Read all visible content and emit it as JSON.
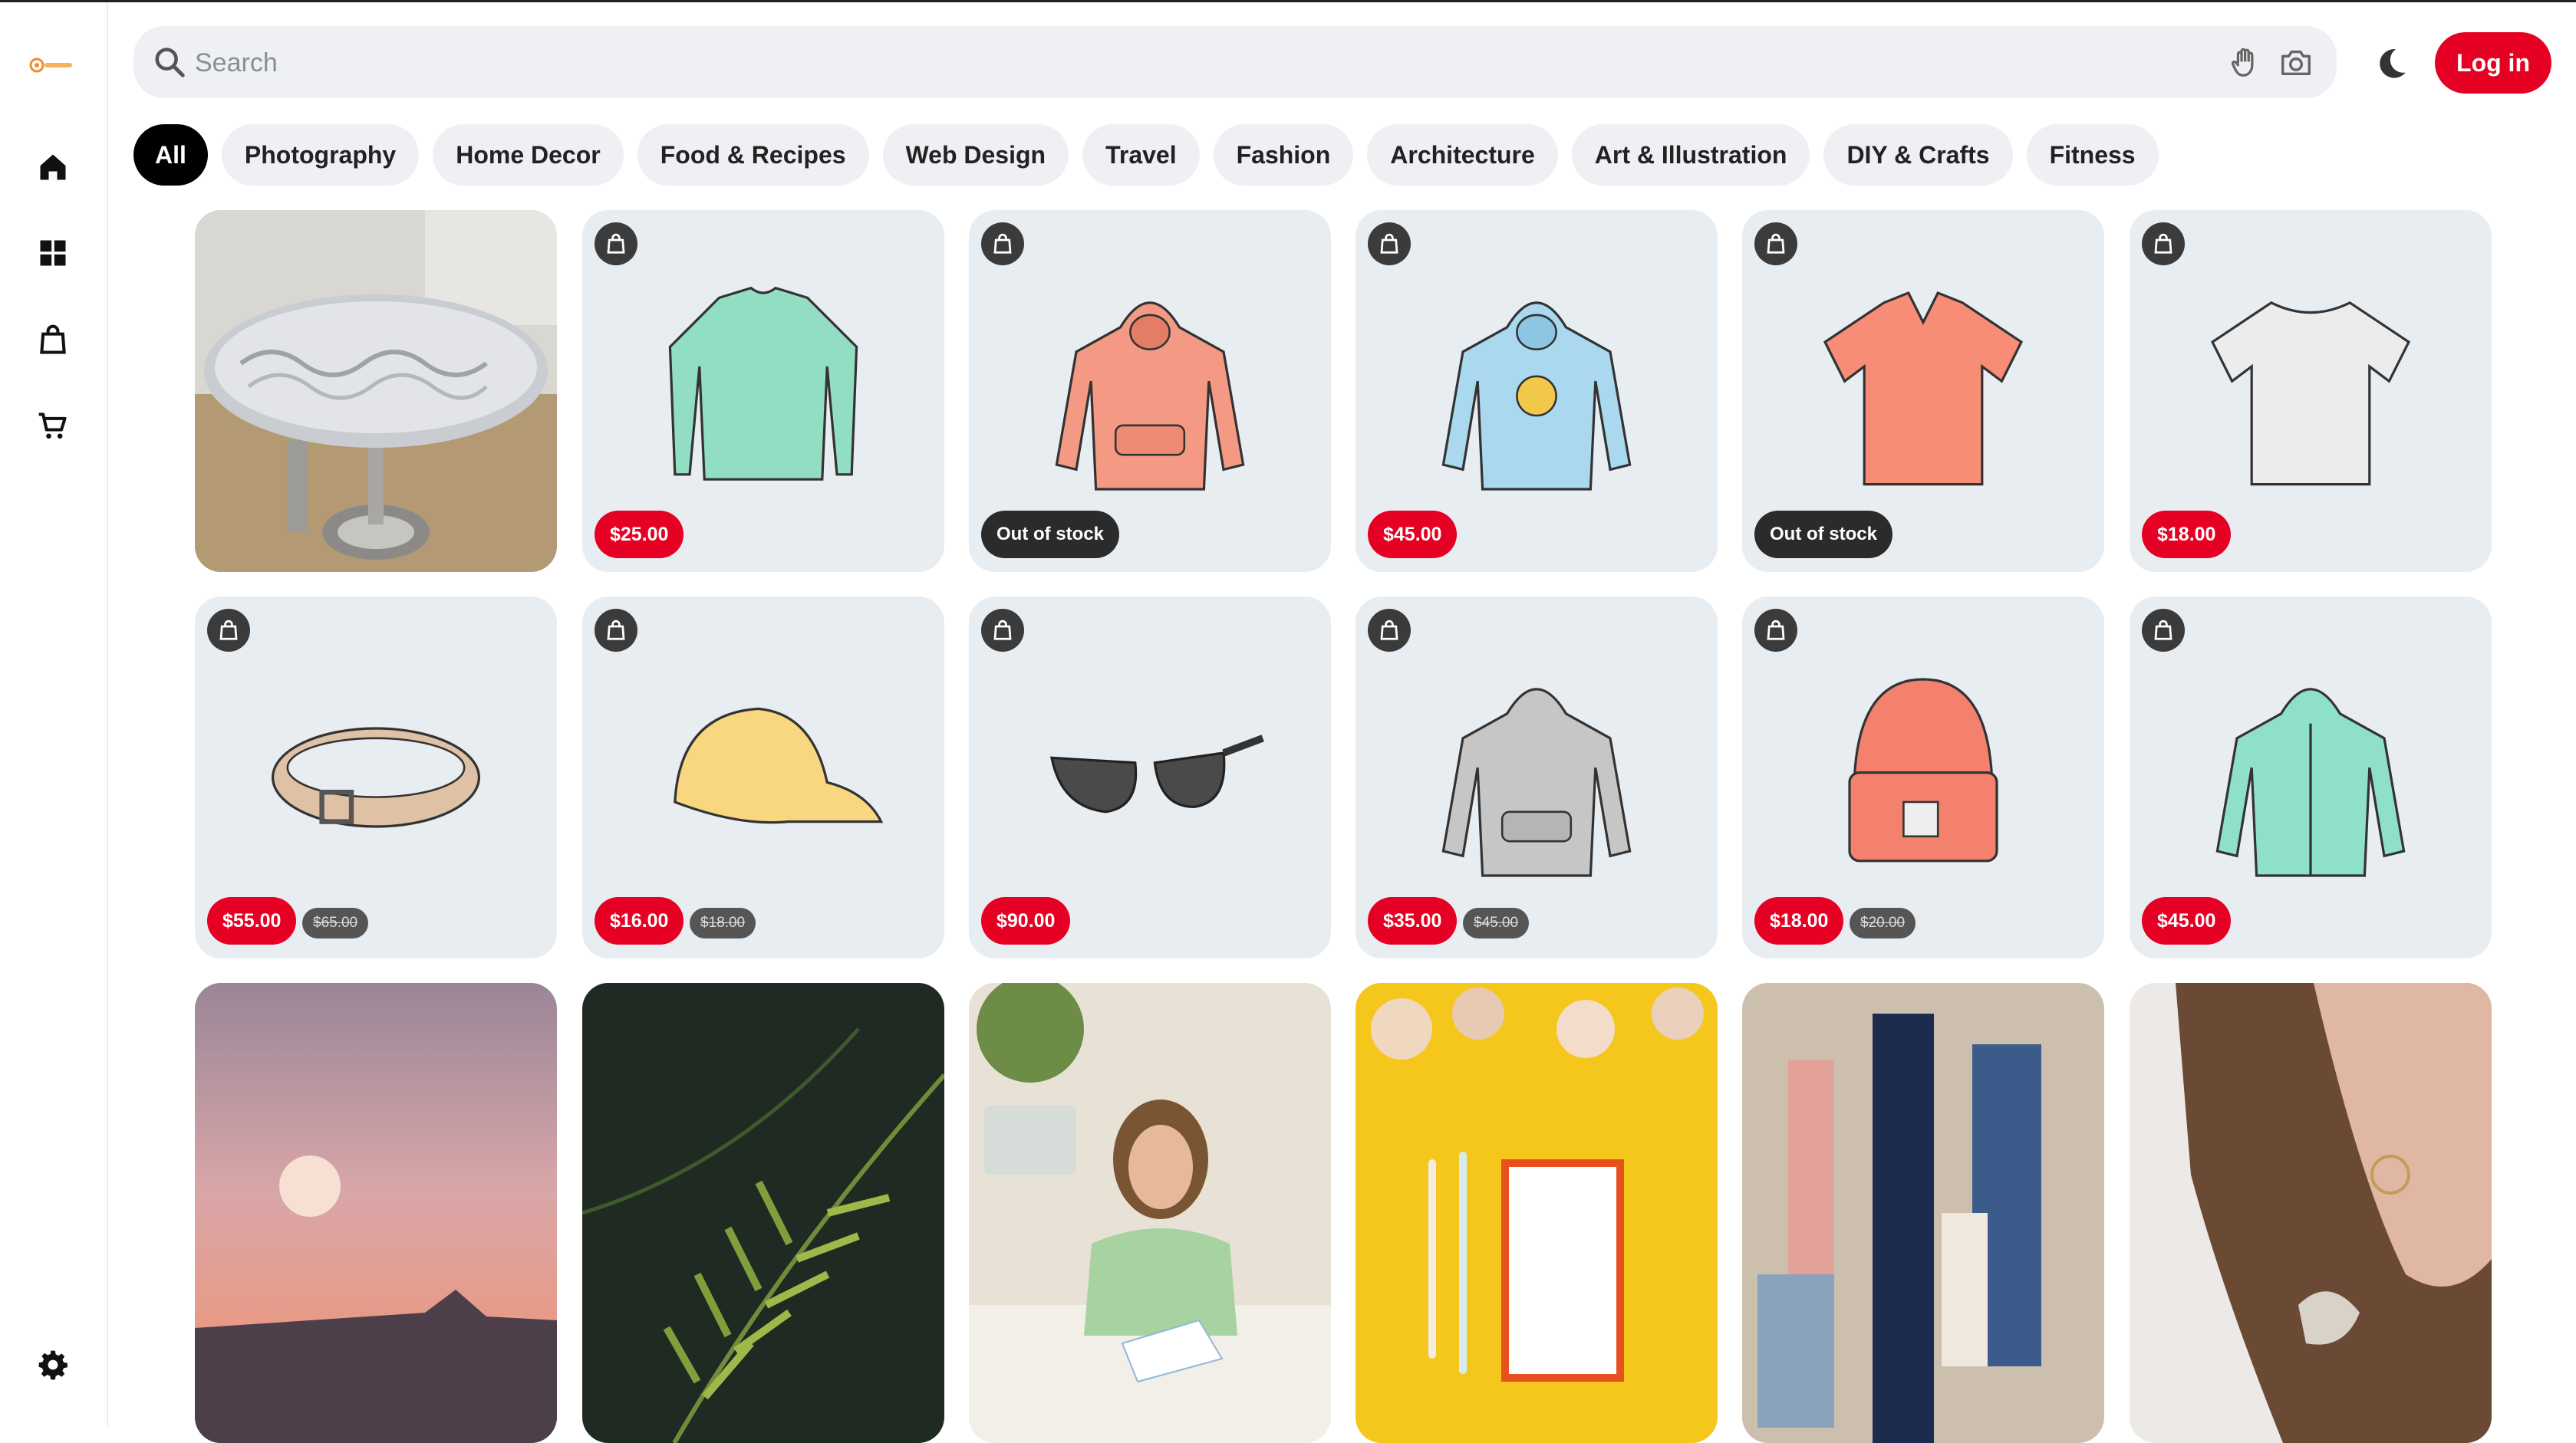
{
  "app": {
    "logo_alt": "logo"
  },
  "search": {
    "placeholder": "Search"
  },
  "header": {
    "login_label": "Log in"
  },
  "sidebar": {
    "items": [
      {
        "name": "home",
        "icon": "home-icon"
      },
      {
        "name": "dashboard",
        "icon": "grid-icon"
      },
      {
        "name": "shop",
        "icon": "bag-icon"
      },
      {
        "name": "cart",
        "icon": "cart-icon"
      }
    ],
    "settings_icon": "gear-icon"
  },
  "categories": [
    "All",
    "Photography",
    "Home Decor",
    "Food & Recipes",
    "Web Design",
    "Travel",
    "Fashion",
    "Architecture",
    "Art & Illustration",
    "DIY & Crafts",
    "Fitness"
  ],
  "active_category": "All",
  "products": [
    {
      "name": "glass side table",
      "type": "photo"
    },
    {
      "name": "mint long sleeve shirt",
      "price": "$25.00"
    },
    {
      "name": "coral hoodie",
      "status": "Out of stock"
    },
    {
      "name": "light blue hoodie",
      "price": "$45.00"
    },
    {
      "name": "coral v-neck t-shirt",
      "status": "Out of stock"
    },
    {
      "name": "white t-shirt",
      "price": "$18.00"
    },
    {
      "name": "tan leather belt",
      "price": "$55.00",
      "old_price": "$65.00"
    },
    {
      "name": "yellow baseball cap",
      "price": "$16.00",
      "old_price": "$18.00"
    },
    {
      "name": "sunglasses",
      "price": "$90.00"
    },
    {
      "name": "grey hoodie",
      "price": "$35.00",
      "old_price": "$45.00"
    },
    {
      "name": "coral beanie",
      "price": "$18.00",
      "old_price": "$20.00"
    },
    {
      "name": "mint zip hoodie",
      "price": "$45.00"
    }
  ],
  "photos": [
    {
      "name": "pink sunset over mountains"
    },
    {
      "name": "fern leaves"
    },
    {
      "name": "girl doing crafts"
    },
    {
      "name": "flowers and stationery on yellow"
    },
    {
      "name": "abstract paint texture"
    },
    {
      "name": "woman with hoop earring"
    }
  ],
  "colors": {
    "accent": "#e60023",
    "chip_bg": "#eef0f3",
    "card_bg": "#e8edf2"
  }
}
